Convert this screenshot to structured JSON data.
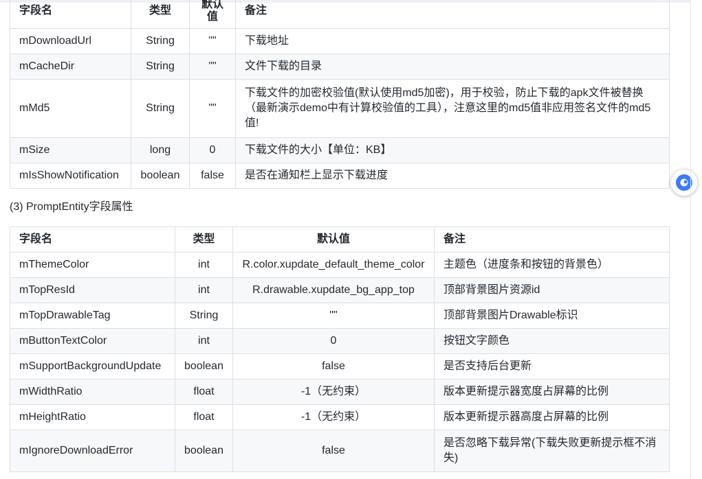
{
  "table1": {
    "headers": [
      "字段名",
      "类型",
      "默认值",
      "备注"
    ],
    "rows": [
      [
        "mDownloadUrl",
        "String",
        "\"\"",
        "下载地址"
      ],
      [
        "mCacheDir",
        "String",
        "\"\"",
        "文件下载的目录"
      ],
      [
        "mMd5",
        "String",
        "\"\"",
        "下载文件的加密校验值(默认使用md5加密)，用于校验，防止下载的apk文件被替换（最新演示demo中有计算校验值的工具），注意这里的md5值非应用签名文件的md5值!"
      ],
      [
        "mSize",
        "long",
        "0",
        "下载文件的大小【单位：KB】"
      ],
      [
        "mIsShowNotification",
        "boolean",
        "false",
        "是否在通知栏上显示下载进度"
      ]
    ]
  },
  "section3": {
    "title": "(3) PromptEntity字段属性"
  },
  "table2": {
    "headers": [
      "字段名",
      "类型",
      "默认值",
      "备注"
    ],
    "rows": [
      [
        "mThemeColor",
        "int",
        "R.color.xupdate_default_theme_color",
        "主题色（进度条和按钮的背景色）"
      ],
      [
        "mTopResId",
        "int",
        "R.drawable.xupdate_bg_app_top",
        "顶部背景图片资源id"
      ],
      [
        "mTopDrawableTag",
        "String",
        "\"\"",
        "顶部背景图片Drawable标识"
      ],
      [
        "mButtonTextColor",
        "int",
        "0",
        "按钮文字颜色"
      ],
      [
        "mSupportBackgroundUpdate",
        "boolean",
        "false",
        "是否支持后台更新"
      ],
      [
        "mWidthRatio",
        "float",
        "-1（无约束）",
        "版本更新提示器宽度占屏幕的比例"
      ],
      [
        "mHeightRatio",
        "float",
        "-1（无约束）",
        "版本更新提示器高度占屏幕的比例"
      ],
      [
        "mIgnoreDownloadError",
        "boolean",
        "false",
        "是否忽略下载异常(下载失败更新提示框不消失)"
      ]
    ]
  },
  "floating_button": {
    "icon": "assistant-icon",
    "color": "#3d7bf7"
  }
}
